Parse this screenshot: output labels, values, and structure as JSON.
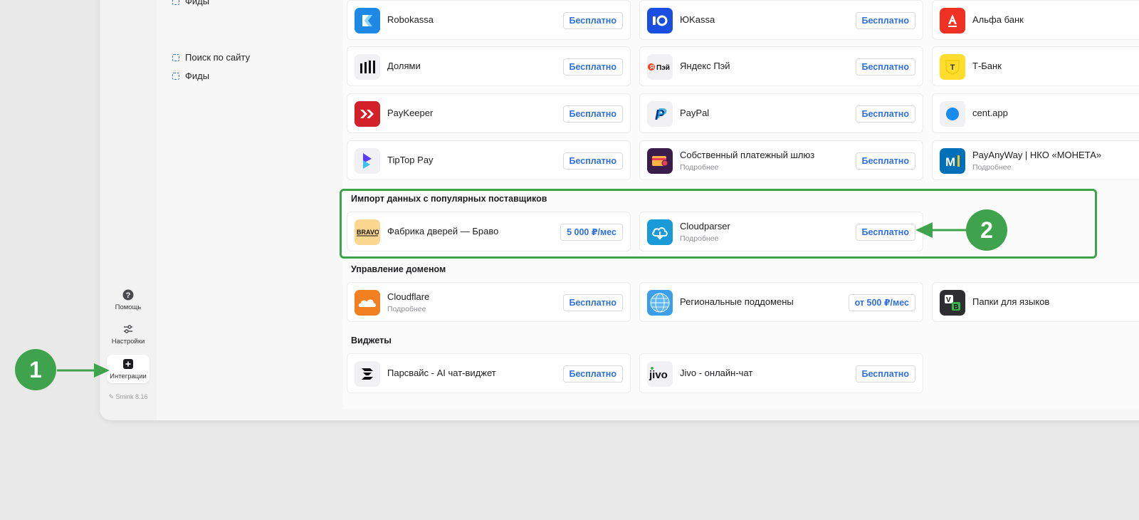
{
  "sidebar": {
    "help_label": "Помощь",
    "settings_label": "Настройки",
    "integrations_label": "Интеграции",
    "version": "Smink 8.16"
  },
  "nav": {
    "top_item": "Фиды",
    "items": [
      "Поиск по сайту",
      "Фиды"
    ]
  },
  "payments": [
    [
      {
        "name": "Robokassa",
        "price": "Бесплатно",
        "icon": "robokassa-logo"
      },
      {
        "name": "ЮKassa",
        "price": "Бесплатно",
        "icon": "yookassa-logo"
      },
      {
        "name": "Альфа банк",
        "icon": "alfa-bank-logo"
      }
    ],
    [
      {
        "name": "Долями",
        "price": "Бесплатно",
        "icon": "dolyami-logo"
      },
      {
        "name": "Яндекс Пэй",
        "price": "Бесплатно",
        "icon": "yandex-pay-logo",
        "logo_text": "Пэй"
      },
      {
        "name": "Т-Банк",
        "icon": "t-bank-logo",
        "logo_text": "T"
      }
    ],
    [
      {
        "name": "PayKeeper",
        "price": "Бесплатно",
        "icon": "paykeeper-logo"
      },
      {
        "name": "PayPal",
        "price": "Бесплатно",
        "icon": "paypal-logo",
        "logo_text": "P"
      },
      {
        "name": "cent.app",
        "icon": "cent-app-logo"
      }
    ],
    [
      {
        "name": "TipTop Pay",
        "price": "Бесплатно",
        "icon": "tiptop-pay-logo"
      },
      {
        "name": "Собственный платежный шлюз",
        "sub": "Подробнее",
        "price": "Бесплатно",
        "icon": "own-gateway-logo"
      },
      {
        "name": "PayAnyWay | НКО «МОНЕТА»",
        "sub": "Подробнее",
        "icon": "payanyway-logo",
        "logo_text": "M"
      }
    ]
  ],
  "sections": {
    "import_title": "Импорт данных с популярных поставщиков",
    "import": [
      {
        "name": "Фабрика дверей — Браво",
        "price": "5 000 ₽/мес",
        "icon": "bravo-logo",
        "logo_text": "BRAVO"
      },
      {
        "name": "Cloudparser",
        "sub": "Подробнее",
        "price": "Бесплатно",
        "icon": "cloudparser-logo"
      }
    ],
    "domain_title": "Управление доменом",
    "domain": [
      {
        "name": "Cloudflare",
        "sub": "Подробнее",
        "price": "Бесплатно",
        "icon": "cloudflare-logo"
      },
      {
        "name": "Региональные поддомены",
        "price": "от 500 ₽/мес",
        "icon": "globe-logo"
      },
      {
        "name": "Папки для языков",
        "icon": "language-folders-logo",
        "logo_text": "VB"
      }
    ],
    "widgets_title": "Виджеты",
    "widgets": [
      {
        "name": "Парсвайс - AI чат-виджет",
        "price": "Бесплатно",
        "icon": "parsvais-logo"
      },
      {
        "name": "Jivo - онлайн-чат",
        "price": "Бесплатно",
        "icon": "jivo-logo",
        "logo_text": "jivo"
      }
    ]
  },
  "annotations": {
    "badge1": "1",
    "badge2": "2"
  },
  "colors": {
    "accent": "#2f6fe4",
    "annotation_green": "#3fa34d"
  }
}
